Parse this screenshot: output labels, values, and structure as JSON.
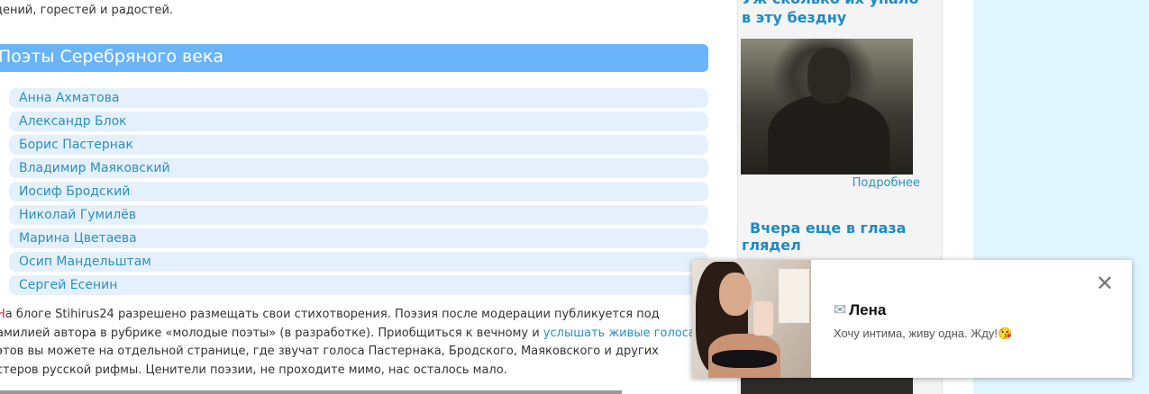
{
  "main": {
    "intro_text": "дений, горестей и радостей.",
    "section_title": "Поэты Серебряного века",
    "poets": [
      "Анна Ахматова",
      "Александр Блок",
      "Борис Пастернак",
      "Владимир Маяковский",
      "Иосиф Бродский",
      "Николай Гумилёв",
      "Марина Цветаева",
      "Осип Мандельштам",
      "Сергей Есенин"
    ],
    "blog": {
      "drop_cap": "Н",
      "line1": "а блоге Stihirus24 разрешено размещать свои стихотворения. Поэзия после модерации публикуется под",
      "line2_before": "амилией автора в рубрике «молодые поэты» (в разработке). Приобщиться к вечному и ",
      "line2_link": "услышать живые голоса",
      "line3": "этов вы можете на отдельной странице, где звучат голоса Пастернака, Бродского, Маяковского и других",
      "line4": "стеров русской рифмы. Ценители поэзии, не проходите мимо, нас осталось мало."
    }
  },
  "sidebar": {
    "title_1": "Уж сколько их упало в эту бездну",
    "more_link": "Подробнее",
    "title_2": "Вчера еще в глаза глядел"
  },
  "notification": {
    "envelope_icon": "✉",
    "name": "Лена",
    "message": "Хочу интима, живу одна. Жду!😘",
    "close_glyph": "✕"
  },
  "colors": {
    "header_bg": "#6ab4fb",
    "link": "#2a8fc2",
    "list_item_bg": "#e4f1fc",
    "side_title": "#1e8ac4",
    "right_strip": "#e0f5fd"
  }
}
